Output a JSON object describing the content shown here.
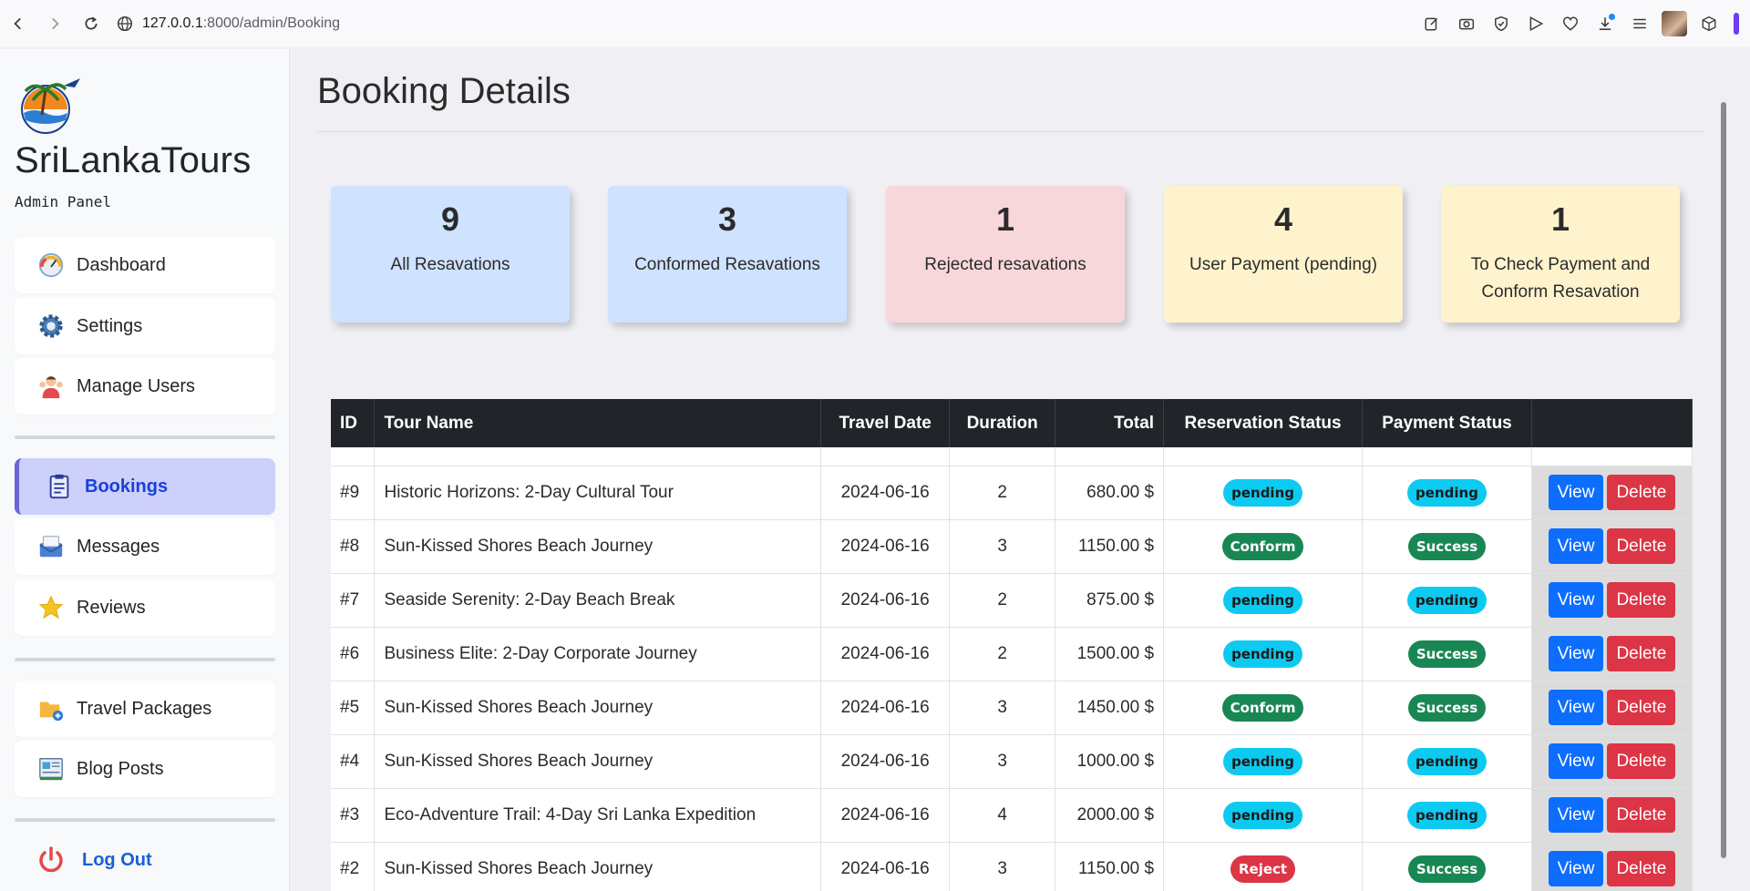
{
  "browser": {
    "url_host": "127.0.0.1",
    "url_path": ":8000/admin/Booking"
  },
  "sidebar": {
    "brand": "SriLankaTours",
    "subtitle": "Admin Panel",
    "items": [
      {
        "label": "Dashboard",
        "icon": "speedometer-icon"
      },
      {
        "label": "Settings",
        "icon": "gear-icon"
      },
      {
        "label": "Manage Users",
        "icon": "users-icon"
      },
      {
        "label": "Bookings",
        "icon": "clipboard-icon",
        "active": true
      },
      {
        "label": "Messages",
        "icon": "messages-icon"
      },
      {
        "label": "Reviews",
        "icon": "star-icon"
      },
      {
        "label": "Travel Packages",
        "icon": "folder-add-icon"
      },
      {
        "label": "Blog Posts",
        "icon": "blog-icon"
      }
    ],
    "logout": "Log Out"
  },
  "main": {
    "title": "Booking Details",
    "stats": [
      {
        "value": "9",
        "label": "All Resavations"
      },
      {
        "value": "3",
        "label": "Conformed Resavations"
      },
      {
        "value": "1",
        "label": "Rejected resavations"
      },
      {
        "value": "4",
        "label": "User Payment (pending)"
      },
      {
        "value": "1",
        "label": "To Check Payment and Conform Resavation"
      }
    ],
    "table": {
      "headers": {
        "id": "ID",
        "tour": "Tour Name",
        "date": "Travel Date",
        "duration": "Duration",
        "total": "Total",
        "res_status": "Reservation Status",
        "pay_status": "Payment Status"
      },
      "view_label": "View",
      "delete_label": "Delete",
      "rows": [
        {
          "id": "#9",
          "tour": "Historic Horizons: 2-Day Cultural Tour",
          "date": "2024-06-16",
          "duration": "2",
          "total": "680.00 $",
          "res": "pending",
          "pay": "pending"
        },
        {
          "id": "#8",
          "tour": "Sun-Kissed Shores Beach Journey",
          "date": "2024-06-16",
          "duration": "3",
          "total": "1150.00 $",
          "res": "Conform",
          "pay": "Success"
        },
        {
          "id": "#7",
          "tour": "Seaside Serenity: 2-Day Beach Break",
          "date": "2024-06-16",
          "duration": "2",
          "total": "875.00 $",
          "res": "pending",
          "pay": "pending"
        },
        {
          "id": "#6",
          "tour": "Business Elite: 2-Day Corporate Journey",
          "date": "2024-06-16",
          "duration": "2",
          "total": "1500.00 $",
          "res": "pending",
          "pay": "Success"
        },
        {
          "id": "#5",
          "tour": "Sun-Kissed Shores Beach Journey",
          "date": "2024-06-16",
          "duration": "3",
          "total": "1450.00 $",
          "res": "Conform",
          "pay": "Success"
        },
        {
          "id": "#4",
          "tour": "Sun-Kissed Shores Beach Journey",
          "date": "2024-06-16",
          "duration": "3",
          "total": "1000.00 $",
          "res": "pending",
          "pay": "pending"
        },
        {
          "id": "#3",
          "tour": "Eco-Adventure Trail: 4-Day Sri Lanka Expedition",
          "date": "2024-06-16",
          "duration": "4",
          "total": "2000.00 $",
          "res": "pending",
          "pay": "pending"
        },
        {
          "id": "#2",
          "tour": "Sun-Kissed Shores Beach Journey",
          "date": "2024-06-16",
          "duration": "3",
          "total": "1150.00 $",
          "res": "Reject",
          "pay": "Success"
        }
      ]
    }
  },
  "colors": {
    "card_blue": "#cfe2ff",
    "card_red": "#f8d7da",
    "card_yellow": "#fff3cd",
    "badge_pending": "#0dcaf0",
    "badge_success": "#198754",
    "badge_reject": "#dc3545",
    "btn_view": "#0d6efd",
    "btn_delete": "#dc3545"
  }
}
